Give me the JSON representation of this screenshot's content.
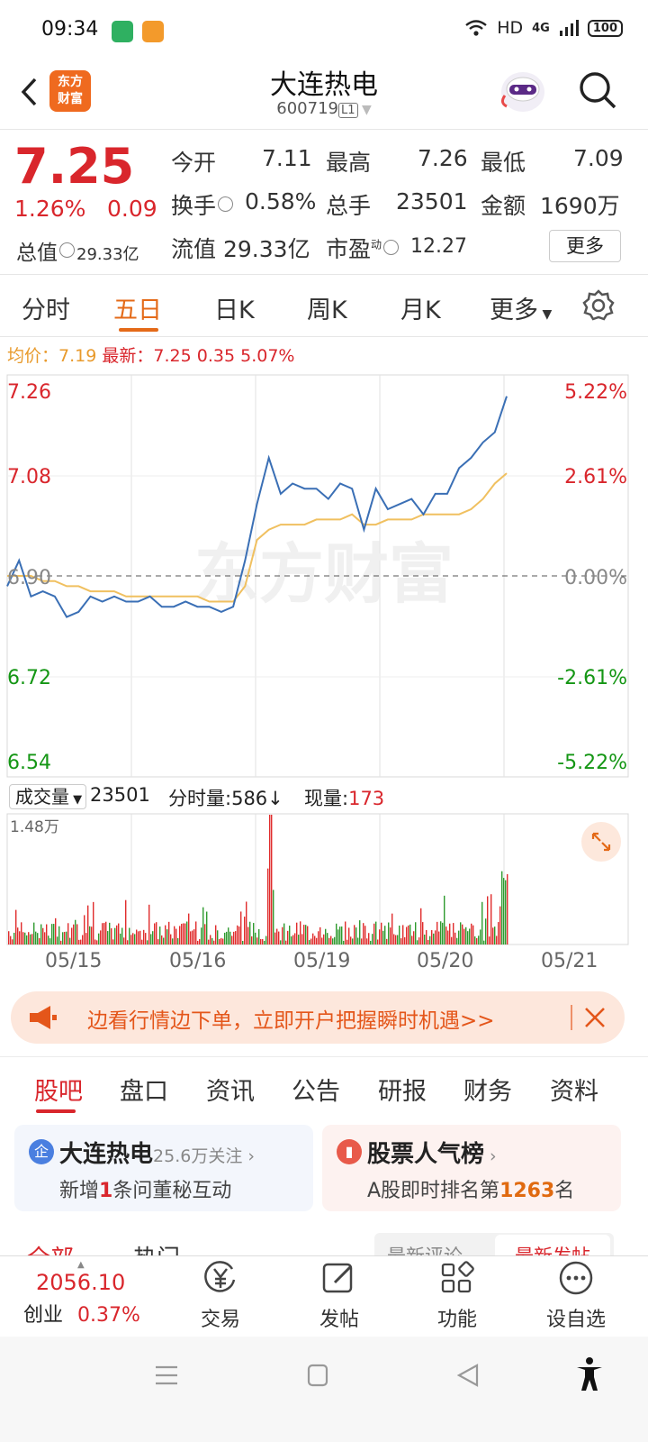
{
  "status": {
    "time": "09:34",
    "network": "HD",
    "signal": "4G",
    "battery": "100"
  },
  "header": {
    "name": "大连热电",
    "code": "600719",
    "level": "L1",
    "logo": [
      "东方",
      "财富"
    ]
  },
  "quote": {
    "price": "7.25",
    "change_pct": "1.26%",
    "change": "0.09",
    "open_label": "今开",
    "open": "7.11",
    "high_label": "最高",
    "high": "7.26",
    "low_label": "最低",
    "low": "7.09",
    "turnover_label": "换手",
    "turnover": "0.58%",
    "volume_label": "总手",
    "volume": "23501",
    "amount_label": "金额",
    "amount": "1690万",
    "mktcap_label": "总值",
    "mktcap": "29.33亿",
    "float_label": "流值",
    "float": "29.33亿",
    "pe_label": "市盈",
    "pe_super": "动",
    "pe": "12.27",
    "more": "更多"
  },
  "tabs": [
    "分时",
    "五日",
    "日K",
    "周K",
    "月K",
    "更多"
  ],
  "legend": {
    "avg_label": "均价：",
    "avg": "7.19",
    "latest_label": "最新：",
    "latest": "7.25",
    "chg": "0.35",
    "pct": "5.07%"
  },
  "chart_data": {
    "type": "line",
    "title": "五日分时",
    "ylim": [
      6.54,
      7.26
    ],
    "y_ticks_left": [
      "7.26",
      "7.08",
      "6.90",
      "6.72",
      "6.54"
    ],
    "y_ticks_right": [
      "5.22%",
      "2.61%",
      "0.00%",
      "-2.61%",
      "-5.22%"
    ],
    "x": [
      "05/15",
      "05/16",
      "05/19",
      "05/20",
      "05/21"
    ],
    "series": [
      {
        "name": "最新",
        "color": "#3a6fb5",
        "values": [
          6.88,
          6.93,
          6.86,
          6.87,
          6.86,
          6.82,
          6.83,
          6.86,
          6.85,
          6.86,
          6.85,
          6.85,
          6.86,
          6.84,
          6.84,
          6.85,
          6.84,
          6.84,
          6.83,
          6.84,
          6.93,
          7.04,
          7.13,
          7.06,
          7.08,
          7.07,
          7.07,
          7.05,
          7.08,
          7.07,
          6.99,
          7.07,
          7.03,
          7.04,
          7.05,
          7.02,
          7.06,
          7.06,
          7.11,
          7.13,
          7.16,
          7.18,
          7.25
        ]
      },
      {
        "name": "均价",
        "color": "#f0c060",
        "values": [
          6.9,
          6.9,
          6.9,
          6.89,
          6.89,
          6.88,
          6.88,
          6.87,
          6.87,
          6.87,
          6.86,
          6.86,
          6.86,
          6.86,
          6.86,
          6.86,
          6.86,
          6.85,
          6.85,
          6.85,
          6.88,
          6.97,
          6.99,
          7.0,
          7.0,
          7.0,
          7.01,
          7.01,
          7.01,
          7.02,
          7.0,
          7.0,
          7.01,
          7.01,
          7.01,
          7.02,
          7.02,
          7.02,
          7.02,
          7.03,
          7.05,
          7.08,
          7.1
        ]
      }
    ],
    "volume": {
      "label": "成交量",
      "total": "23501",
      "ymax_label": "1.48万",
      "colors": {
        "up": "#e02b2b",
        "down": "#2e9a2e"
      }
    }
  },
  "volbar": {
    "period_label": "分时量:",
    "period": "586↓",
    "now_label": "现量:",
    "now": "173"
  },
  "watermark": "东方财富",
  "banner": {
    "text": "边看行情边下单，立即开户把握瞬时机遇>>"
  },
  "sections": [
    "股吧",
    "盘口",
    "资讯",
    "公告",
    "研报",
    "财务",
    "资料"
  ],
  "card1": {
    "icon": "企",
    "title": "大连热电",
    "meta": "25.6万关注",
    "sub_pre": "新增",
    "sub_num": "1",
    "sub_post": "条问董秘互动"
  },
  "card2": {
    "title": "股票人气榜",
    "sub_pre": "A股即时排名第",
    "sub_num": "1263",
    "sub_post": "名"
  },
  "peek": {
    "t1": "全部",
    "t2": "热门",
    "t3": "最新评论",
    "t4": "最新发帖"
  },
  "bottom": {
    "index_value": "2056.10",
    "index_name": "创业",
    "index_pct": "0.37%",
    "trade": "交易",
    "post": "发帖",
    "func": "功能",
    "watch": "设自选"
  }
}
